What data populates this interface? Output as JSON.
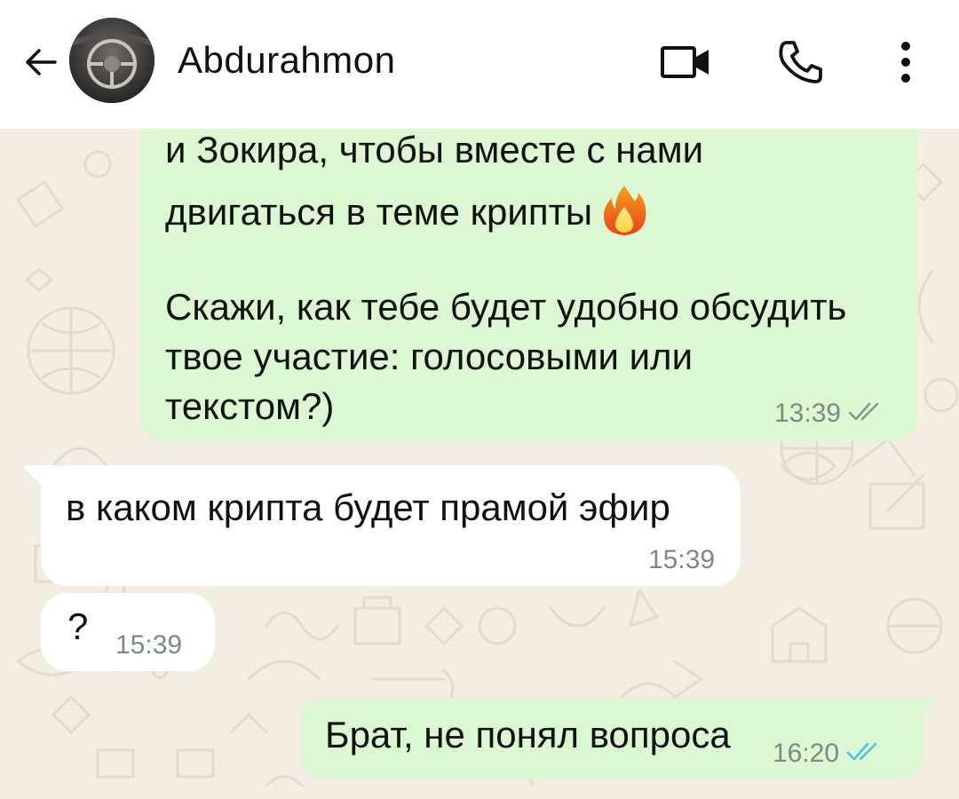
{
  "header": {
    "contact_name": "Abdurahmon",
    "back_icon": "arrow-left-icon",
    "video_icon": "video-call-icon",
    "phone_icon": "phone-call-icon",
    "menu_icon": "more-vert-icon"
  },
  "messages": [
    {
      "direction": "outgoing",
      "lines": [
        "и Зокира, чтобы вместе с нами",
        "двигаться в теме крипты",
        "Скажи, как тебе будет удобно обсудить",
        "твое участие: голосовыми или",
        "текстом?)"
      ],
      "emoji": "fire-emoji",
      "time": "13:39",
      "status": "delivered"
    },
    {
      "direction": "incoming",
      "text": "в каком крипта будет прамой эфир",
      "time": "15:39"
    },
    {
      "direction": "incoming",
      "text": "?",
      "time": "15:39"
    },
    {
      "direction": "outgoing",
      "text": "Брат, не понял вопроса",
      "time": "16:20",
      "status": "read"
    }
  ],
  "colors": {
    "outgoing_bubble": "#dbf8d2",
    "incoming_bubble": "#ffffff",
    "read_ticks": "#53bdeb",
    "delivered_ticks": "#8a9591",
    "wallpaper": "#f3ede3"
  }
}
